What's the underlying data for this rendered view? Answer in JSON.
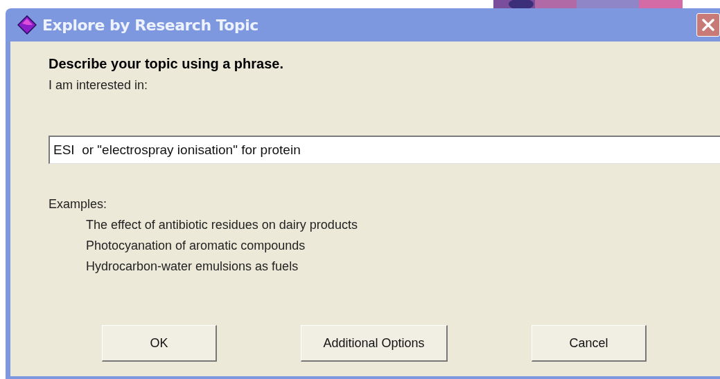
{
  "window": {
    "title": "Explore by Research Topic"
  },
  "heading": "Describe your topic using a phrase.",
  "field_label": "I am interested in:",
  "topic_field": {
    "value": "ESI  or \"electrospray ionisation\" for protein"
  },
  "examples_label": "Examples:",
  "examples": [
    "The effect of antibiotic residues on dairy products",
    "Photocyanation of aromatic compounds",
    "Hydrocarbon-water emulsions as fuels"
  ],
  "buttons": [
    "OK",
    "Additional Options",
    "Cancel"
  ]
}
